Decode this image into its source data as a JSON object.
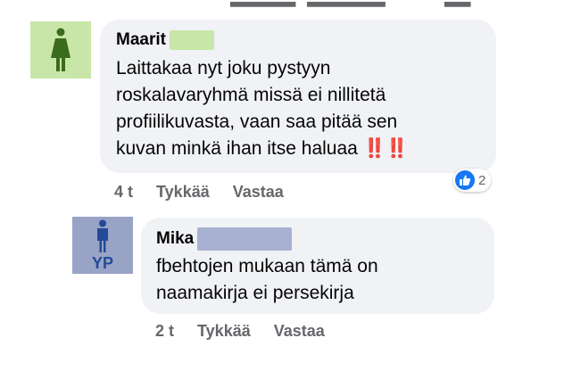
{
  "comments": [
    {
      "author": "Maarit",
      "text_lines": [
        "Laittakaa nyt joku pystyyn",
        "roskalavaryhmä missä ei nillitetä",
        "profiilikuvasta, vaan saa pitää sen",
        "kuvan minkä ihan itse haluaa"
      ],
      "emoji": "‼️‼️",
      "time": "4 t",
      "like_label": "Tykkää",
      "reply_label": "Vastaa",
      "reaction_count": "2",
      "avatar_icon": "female-person-icon"
    },
    {
      "author": "Mika",
      "text_lines": [
        "fbehtojen mukaan tämä on",
        "naamakirja ei persekirja"
      ],
      "time": "2 t",
      "like_label": "Tykkää",
      "reply_label": "Vastaa",
      "avatar_initials": "YP",
      "avatar_icon": "male-person-icon"
    }
  ],
  "colors": {
    "bubble": "#f0f2f5",
    "female_avatar_bg": "#c8e6a7",
    "male_avatar_bg": "#98a3c5",
    "like_blue": "#1877f2",
    "meta_gray": "#65676b"
  }
}
